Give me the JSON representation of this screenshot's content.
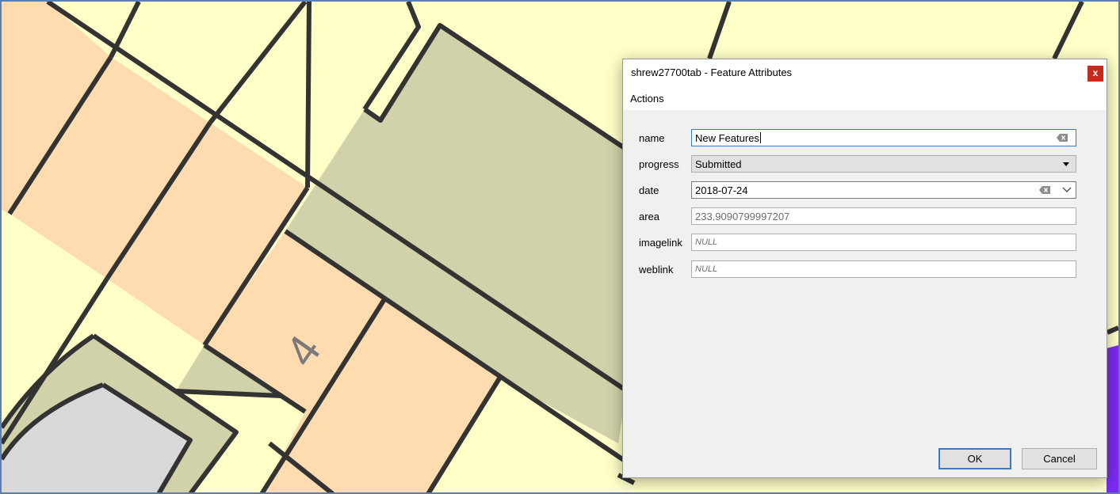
{
  "map": {
    "label_text": "4"
  },
  "dialog": {
    "title": "shrew27700tab - Feature Attributes",
    "close_glyph": "x",
    "menu": {
      "actions": "Actions"
    },
    "fields": [
      {
        "label": "name",
        "value": "New Features"
      },
      {
        "label": "progress",
        "value": "Submitted"
      },
      {
        "label": "date",
        "value": "2018-07-24"
      },
      {
        "label": "area",
        "value": "233.9090799997207"
      },
      {
        "label": "imagelink",
        "value": "NULL"
      },
      {
        "label": "weblink",
        "value": "NULL"
      }
    ],
    "buttons": {
      "ok": "OK",
      "cancel": "Cancel"
    }
  },
  "colors": {
    "parcel_cream": "#ffffc8",
    "parcel_peach": "#ffdbb0",
    "parcel_olive": "#d2d2aa",
    "parcel_grey": "#d9d9d9",
    "parcel_blue": "#7a2cf0",
    "outline": "#333333",
    "accent": "#3b78c7",
    "close": "#c42b1c"
  }
}
